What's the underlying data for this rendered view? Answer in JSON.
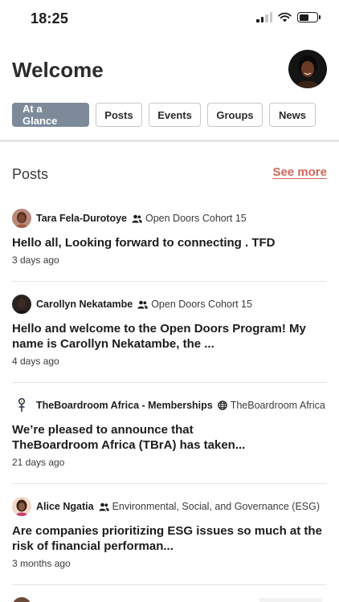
{
  "status_bar": {
    "time": "18:25"
  },
  "header": {
    "title": "Welcome"
  },
  "tabs": [
    {
      "label": "At a Glance",
      "active": true
    },
    {
      "label": "Posts",
      "active": false
    },
    {
      "label": "Events",
      "active": false
    },
    {
      "label": "Groups",
      "active": false
    },
    {
      "label": "News",
      "active": false
    }
  ],
  "posts_section": {
    "title": "Posts",
    "see_more": "See more",
    "items": [
      {
        "author": "Tara Fela-Durotoye",
        "group_icon": "people-icon",
        "group": "Open Doors Cohort 15",
        "line1": "Hello all, Looking forward to connecting . TFD",
        "line2": "",
        "time": "3 days ago"
      },
      {
        "author": "Carollyn Nekatambe",
        "group_icon": "people-icon",
        "group": "Open Doors Cohort 15",
        "line1": "Hello and welcome to the Open Doors Program! My",
        "line2": "name is Carollyn Nekatambe, the ...",
        "time": "4 days ago"
      },
      {
        "author": "TheBoardroom Africa - Memberships",
        "group_icon": "globe-icon",
        "group": "TheBoardroom Africa",
        "line1": "We’re pleased to announce that",
        "line2": "TheBoardroom Africa (TBrA) has taken...",
        "time": "21 days ago"
      },
      {
        "author": "Alice Ngatia",
        "group_icon": "people-icon",
        "group": "Environmental, Social, and Governance (ESG)",
        "line1": "Are companies prioritizing ESG issues so much at the",
        "line2": "risk of financial performan...",
        "time": "3 months ago"
      }
    ]
  },
  "colors": {
    "accent": "#d2665a",
    "active_tab": "#7c8a99",
    "divider": "#e5e5ea"
  }
}
